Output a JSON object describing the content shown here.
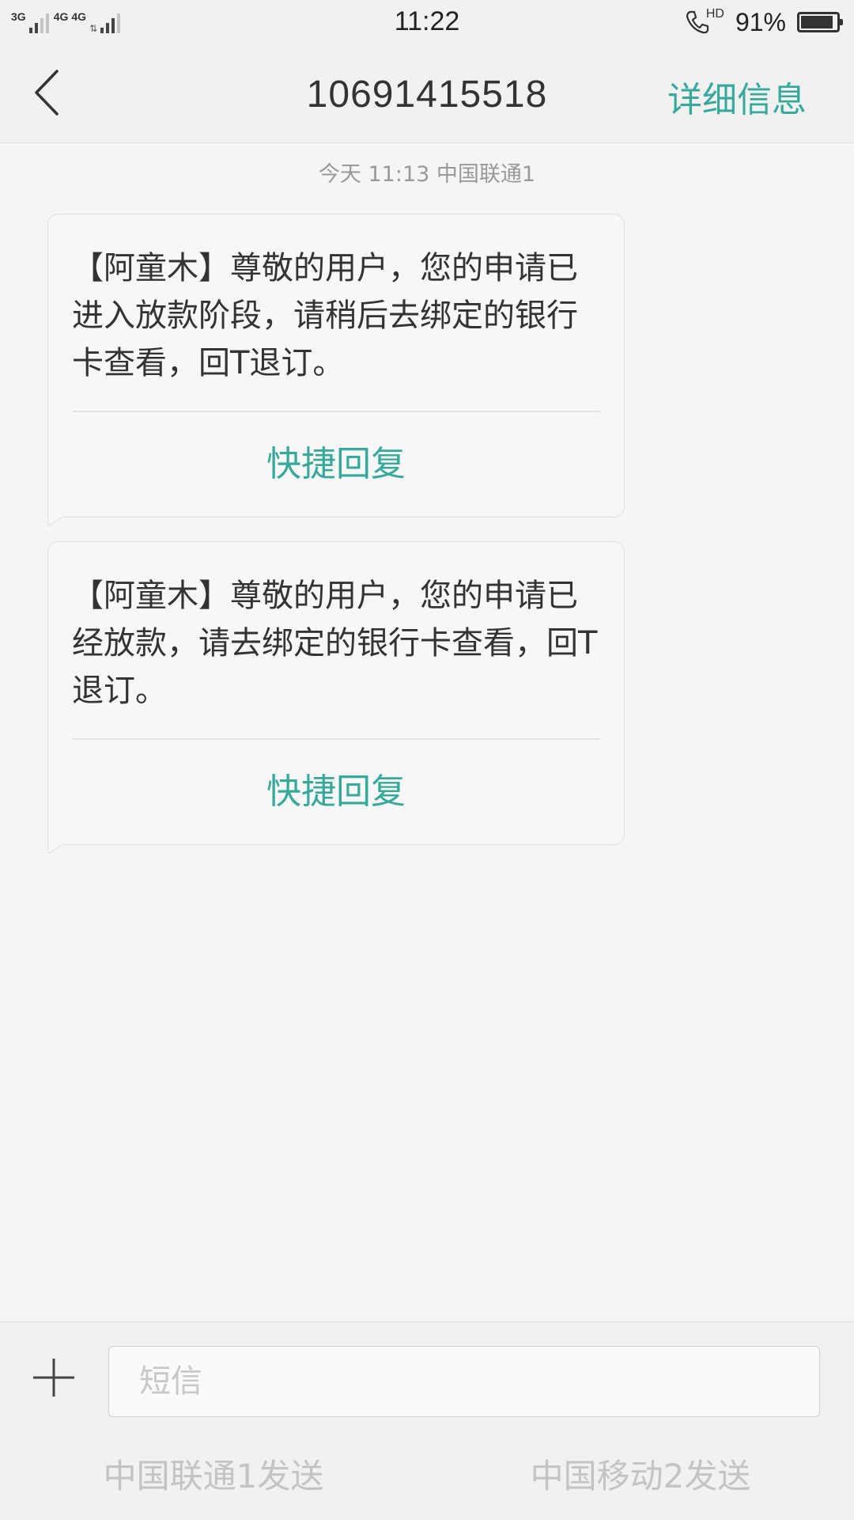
{
  "status_bar": {
    "network1_label": "3G",
    "network2_label": "4G",
    "network3_label": "4G",
    "arrows": "⇅",
    "time": "11:22",
    "call_badge": "HD",
    "battery_percent_text": "91%",
    "battery_level": 0.91
  },
  "header": {
    "title": "10691415518",
    "detail_label": "详细信息"
  },
  "conversation": {
    "date_label": "今天  11:13  中国联通1",
    "messages": [
      {
        "text": "【阿童木】尊敬的用户，您的申请已进入放款阶段，请稍后去绑定的银行卡查看，回T退订。",
        "quick_reply_label": "快捷回复"
      },
      {
        "text": "【阿童木】尊敬的用户，您的申请已经放款，请去绑定的银行卡查看，回T退订。",
        "quick_reply_label": "快捷回复"
      }
    ]
  },
  "composer": {
    "input_value": "",
    "input_placeholder": "短信",
    "send_sim1_label": "中国联通1发送",
    "send_sim2_label": "中国移动2发送"
  },
  "icons": {
    "back": "chevron-left-icon",
    "add": "plus-icon",
    "call": "phone-hd-icon",
    "battery": "battery-icon",
    "signal": "signal-bars-icon"
  },
  "colors": {
    "accent": "#36a99a",
    "background": "#f5f5f5",
    "bar": "#f1f1f1",
    "send_disabled": "#c4c4c4"
  }
}
